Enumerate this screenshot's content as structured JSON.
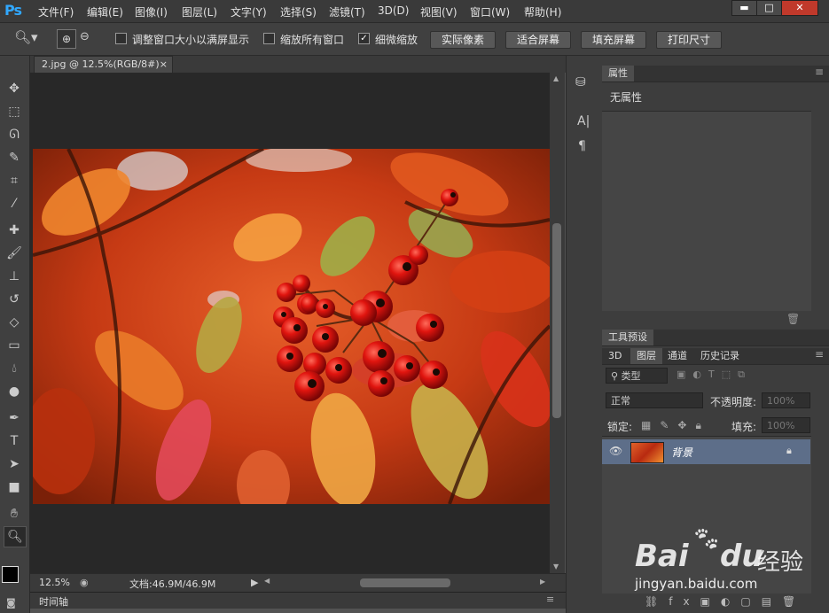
{
  "app": {
    "logo": "Ps"
  },
  "menu": [
    "文件(F)",
    "编辑(E)",
    "图像(I)",
    "图层(L)",
    "文字(Y)",
    "选择(S)",
    "滤镜(T)",
    "3D(D)",
    "视图(V)",
    "窗口(W)",
    "帮助(H)"
  ],
  "window_controls": {
    "minimize": "▬",
    "restore": "□",
    "close": "✕"
  },
  "options": {
    "resize_windows": "调整窗口大小以满屏显示",
    "zoom_all": "缩放所有窗口",
    "scrubby_zoom": "细微缩放",
    "scrubby_checked": true,
    "btn_actual": "实际像素",
    "btn_fit": "适合屏幕",
    "btn_fill": "填充屏幕",
    "btn_print": "打印尺寸"
  },
  "document": {
    "tab_title": "2.jpg @ 12.5%(RGB/8#)",
    "zoom": "12.5%",
    "doc_size": "文档:46.9M/46.9M",
    "timeline": "时间轴"
  },
  "properties": {
    "tab": "属性",
    "empty": "无属性"
  },
  "tool_presets": {
    "tab": "工具预设"
  },
  "layers_panel": {
    "tabs": [
      "3D",
      "图层",
      "通道",
      "历史记录"
    ],
    "filter_kind": "类型",
    "blend_mode": "正常",
    "opacity_label": "不透明度:",
    "opacity_value": "100%",
    "lock_label": "锁定:",
    "fill_label": "填充:",
    "fill_value": "100%",
    "layer_name": "背景"
  },
  "watermark": {
    "brand": "Bai",
    "brand2": "du",
    "cn": "经验",
    "url": "jingyan.baidu.com"
  },
  "colors": {
    "accent": "#31a8ff",
    "layer_selected": "#5d6e89",
    "panel": "#3d3d3d"
  }
}
